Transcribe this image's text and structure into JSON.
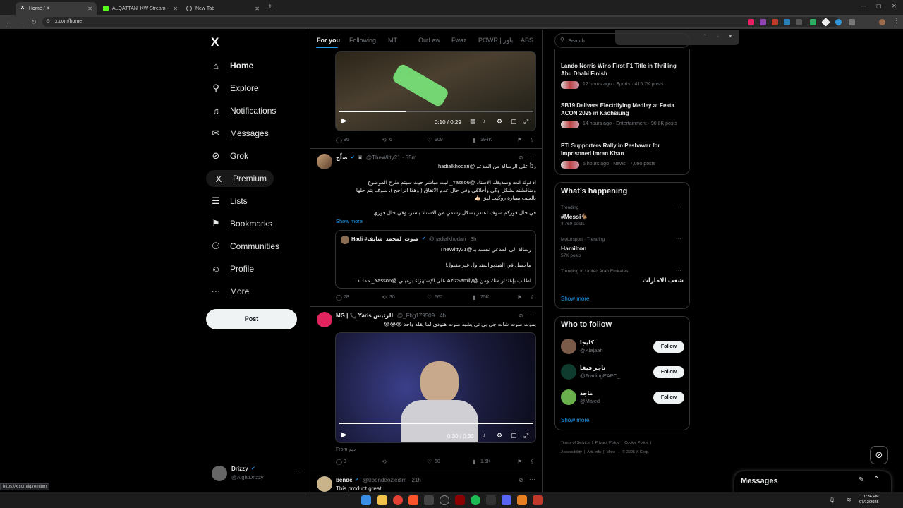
{
  "browser": {
    "tabs": [
      {
        "title": "Home / X",
        "active": true
      },
      {
        "title": "ALQATTAN_KW Stream - Watch",
        "active": false
      },
      {
        "title": "New Tab",
        "active": false
      }
    ],
    "url": "x.com/home",
    "status_url": "https://x.com/i/premium"
  },
  "find_bar": {
    "prev": "⌃",
    "next": "⌄",
    "close": "✕"
  },
  "sidebar": {
    "logo": "X",
    "items": [
      {
        "label": "Home",
        "icon": "home-icon",
        "glyph": "⌂"
      },
      {
        "label": "Explore",
        "icon": "search-icon",
        "glyph": "⚲"
      },
      {
        "label": "Notifications",
        "icon": "bell-icon",
        "glyph": "♫"
      },
      {
        "label": "Messages",
        "icon": "envelope-icon",
        "glyph": "✉"
      },
      {
        "label": "Grok",
        "icon": "grok-icon",
        "glyph": "⊘"
      },
      {
        "label": "Premium",
        "icon": "x-premium-icon",
        "glyph": "X"
      },
      {
        "label": "Lists",
        "icon": "list-icon",
        "glyph": "☰"
      },
      {
        "label": "Bookmarks",
        "icon": "bookmark-icon",
        "glyph": "⚑"
      },
      {
        "label": "Communities",
        "icon": "communities-icon",
        "glyph": "⚇"
      },
      {
        "label": "Profile",
        "icon": "profile-icon",
        "glyph": "☺"
      },
      {
        "label": "More",
        "icon": "more-icon",
        "glyph": "⋯"
      }
    ],
    "post_button": "Post",
    "account": {
      "name": "Drizzy",
      "handle": "@AightDrizzy",
      "more": "···"
    }
  },
  "timeline_tabs": [
    "For you",
    "Following",
    "MT",
    "OutLaw",
    "Fwaz",
    "POWR | باور",
    "ABS"
  ],
  "tweets": [
    {
      "video_time": "0:10 / 0:29",
      "stats": {
        "replies": "36",
        "reposts": "6",
        "likes": "909",
        "views": "194K"
      }
    },
    {
      "author": "صلّح",
      "handle": "@TheWitty21 · 55m",
      "lines": [
        "ردّاً على الرسالة من المدعو @hadialkhodari",
        "ادعوك انت وصديقك الاستاذ @Yasso6_ لبث مباشر حيث سيتم طرح الموضوع",
        "ومناقشته بشكل وكي وأخلاقي وفي حال عدم الاتفاق ( وهذا الراجح )، سوف يتم حلها",
        "بالعنف بمبارة روكيت ليق 👍🏻",
        "في حال فوزكم سوف اعتذر بشكل رسمي من الاستاذ ياسر، وفي حال فوزي"
      ],
      "show_more": "Show more",
      "quote": {
        "author": "Hadi #صوت_لمحمد_شايف",
        "handle": "@hadialkhodari · 3h",
        "lines": [
          "رسالة الى المدعي نفسه بـ @TheWitty21",
          "ماحصل في الفيديو المتداول غير مقبول!",
          "اطالب بإعتذار منك ومن @AzizSamily على الإستهزاء برميلي @Yasso6_ مما اد..."
        ]
      },
      "stats": {
        "replies": "78",
        "reposts": "30",
        "likes": "662",
        "views": "75K"
      }
    },
    {
      "author": "MG | 📞 Yaris الرئيس",
      "handle": "@_Fhg179509 · 4h",
      "text": "يموت صوت شات جي بي تي يشبه صوت هنودي لما يقلد واحد 😭😭😭",
      "video_time": "0:30 / 0:33",
      "from": "From ديم",
      "stats": {
        "replies": "3",
        "reposts": "",
        "likes": "50",
        "views": "1.5K"
      }
    },
    {
      "author": "bende",
      "handle": "@0bendeozledim · 21h",
      "text": "This product great"
    }
  ],
  "search": {
    "placeholder": "Search"
  },
  "news": [
    {
      "title": "Lando Norris Wins First F1 Title in Thrilling Abu Dhabi Finish",
      "meta": "12 hours ago · Sports · 415.7K posts"
    },
    {
      "title": "SB19 Delivers Electrifying Medley at Festa ACON 2025 in Kaohsiung",
      "meta": "14 hours ago · Entertainment · 90.8K posts"
    },
    {
      "title": "PTI Supporters Rally in Peshawar for Imprisoned Imran Khan",
      "meta": "5 hours ago · News · 7,090 posts"
    }
  ],
  "whats_happening": {
    "title": "What’s happening",
    "trends": [
      {
        "context": "Trending",
        "name": "#Messi🐐",
        "count": "4,769 posts"
      },
      {
        "context": "Motorsport · Trending",
        "name": "Hamilton",
        "count": "57K posts"
      },
      {
        "context": "Trending in United Arab Emirates",
        "name": "شعب الامارات",
        "count": ""
      }
    ],
    "show_more": "Show more"
  },
  "who_to_follow": {
    "title": "Who to follow",
    "users": [
      {
        "name": "كليجا",
        "handle": "@Klejaah"
      },
      {
        "name": "تاجر فيفا",
        "handle": "@TradingEAFC_"
      },
      {
        "name": "ماجد",
        "handle": "@Majed_"
      }
    ],
    "follow_label": "Follow",
    "show_more": "Show more"
  },
  "footer_links": [
    "Terms of Service",
    "Privacy Policy",
    "Cookie Policy",
    "Accessibility",
    "Ads info",
    "More ···",
    "© 2025 X Corp."
  ],
  "messages_drawer": {
    "title": "Messages"
  },
  "taskbar": {
    "time": "10:34 PM",
    "date": "07/12/2025"
  },
  "colors": {
    "accent": "#1d9bf0",
    "background": "#000000",
    "border": "#2f3336"
  }
}
